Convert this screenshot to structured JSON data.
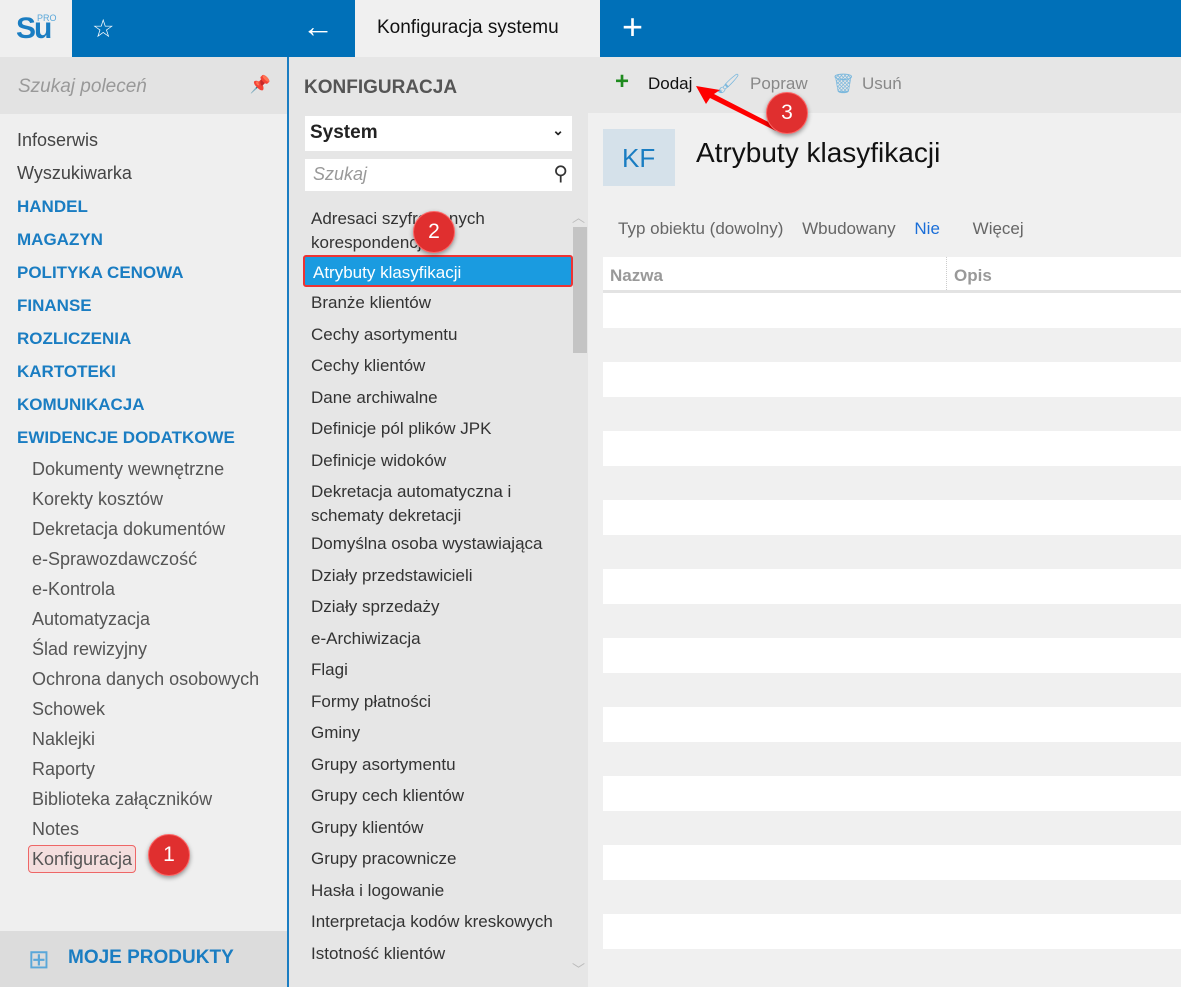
{
  "app": {
    "logo": "Su",
    "logo_sup": "PRO",
    "tab_title": "Konfiguracja systemu"
  },
  "left": {
    "search_placeholder": "Szukaj poleceń",
    "items": [
      {
        "label": "Infoserwis",
        "type": "plain"
      },
      {
        "label": "Wyszukiwarka",
        "type": "plain"
      },
      {
        "label": "HANDEL",
        "type": "sec"
      },
      {
        "label": "MAGAZYN",
        "type": "sec"
      },
      {
        "label": "POLITYKA CENOWA",
        "type": "sec"
      },
      {
        "label": "FINANSE",
        "type": "sec"
      },
      {
        "label": "ROZLICZENIA",
        "type": "sec"
      },
      {
        "label": "KARTOTEKI",
        "type": "sec"
      },
      {
        "label": "KOMUNIKACJA",
        "type": "sec"
      },
      {
        "label": "EWIDENCJE DODATKOWE",
        "type": "sec"
      },
      {
        "label": "Dokumenty wewnętrzne",
        "type": "sub"
      },
      {
        "label": "Korekty kosztów",
        "type": "sub"
      },
      {
        "label": "Dekretacja dokumentów",
        "type": "sub"
      },
      {
        "label": "e-Sprawozdawczość",
        "type": "sub"
      },
      {
        "label": "e-Kontrola",
        "type": "sub"
      },
      {
        "label": "Automatyzacja",
        "type": "sub"
      },
      {
        "label": "Ślad rewizyjny",
        "type": "sub"
      },
      {
        "label": "Ochrona danych osobowych",
        "type": "sub"
      },
      {
        "label": "Schowek",
        "type": "sub"
      },
      {
        "label": "Naklejki",
        "type": "sub"
      },
      {
        "label": "Raporty",
        "type": "sub"
      },
      {
        "label": "Biblioteka załączników",
        "type": "sub"
      },
      {
        "label": "Notes",
        "type": "sub"
      },
      {
        "label": "Konfiguracja",
        "type": "sub",
        "highlight": true
      }
    ],
    "footer": "MOJE PRODUKTY"
  },
  "middle": {
    "heading": "KONFIGURACJA",
    "select_value": "System",
    "search_placeholder": "Szukaj",
    "items": [
      "Adresaci szyfrowanych korespondencji",
      "Atrybuty klasyfikacji",
      "Branże klientów",
      "Cechy asortymentu",
      "Cechy klientów",
      "Dane archiwalne",
      "Definicje pól plików JPK",
      "Definicje widoków",
      "Dekretacja automatyczna i schematy dekretacji",
      "Domyślna osoba wystawiająca",
      "Działy przedstawicieli",
      "Działy sprzedaży",
      "e-Archiwizacja",
      "Flagi",
      "Formy płatności",
      "Gminy",
      "Grupy asortymentu",
      "Grupy cech klientów",
      "Grupy klientów",
      "Grupy pracownicze",
      "Hasła i logowanie",
      "Interpretacja kodów kreskowych",
      "Istotność klientów"
    ],
    "active_index": 1
  },
  "toolbar": {
    "add": "Dodaj",
    "edit": "Popraw",
    "delete": "Usuń"
  },
  "content": {
    "badge": "KF",
    "title": "Atrybuty klasyfikacji",
    "filters": {
      "type": "Typ obiektu (dowolny)",
      "builtin_label": "Wbudowany",
      "builtin_value": "Nie",
      "more": "Więcej"
    },
    "columns": [
      "Nazwa",
      "Opis"
    ]
  },
  "annotations": [
    "1",
    "2",
    "3"
  ],
  "colors": {
    "brand": "#0070b8",
    "accent": "#1a7dc2",
    "annotation": "#e02f2f"
  }
}
